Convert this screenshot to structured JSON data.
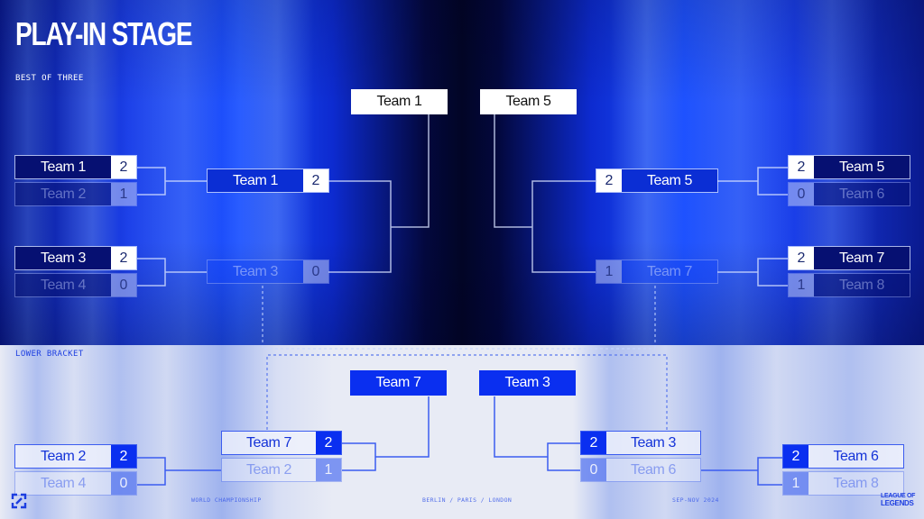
{
  "header": {
    "title": "PLAY-IN STAGE",
    "subtitle": "BEST OF THREE",
    "lower_label": "LOWER BRACKET"
  },
  "upper": {
    "left_r1": [
      {
        "top": {
          "team": "Team 1",
          "score": "2"
        },
        "bottom": {
          "team": "Team 2",
          "score": "1"
        }
      },
      {
        "top": {
          "team": "Team 3",
          "score": "2"
        },
        "bottom": {
          "team": "Team 4",
          "score": "0"
        }
      }
    ],
    "left_r2": {
      "top": {
        "team": "Team 1",
        "score": "2"
      },
      "bottom": {
        "team": "Team 3",
        "score": "0"
      }
    },
    "left_winner": "Team 1",
    "right_r1": [
      {
        "top": {
          "team": "Team 5",
          "score": "2"
        },
        "bottom": {
          "team": "Team 6",
          "score": "0"
        }
      },
      {
        "top": {
          "team": "Team 7",
          "score": "2"
        },
        "bottom": {
          "team": "Team 8",
          "score": "1"
        }
      }
    ],
    "right_r2": {
      "top": {
        "team": "Team 5",
        "score": "2"
      },
      "bottom": {
        "team": "Team 7",
        "score": "1"
      }
    },
    "right_winner": "Team 5"
  },
  "lower": {
    "left_r1": {
      "top": {
        "team": "Team 2",
        "score": "2"
      },
      "bottom": {
        "team": "Team 4",
        "score": "0"
      }
    },
    "left_r2": {
      "top": {
        "team": "Team 7",
        "score": "2"
      },
      "bottom": {
        "team": "Team 2",
        "score": "1"
      }
    },
    "left_winner": "Team 7",
    "right_r1": {
      "top": {
        "team": "Team 6",
        "score": "2"
      },
      "bottom": {
        "team": "Team 8",
        "score": "1"
      }
    },
    "right_r2": {
      "top": {
        "team": "Team 3",
        "score": "2"
      },
      "bottom": {
        "team": "Team 6",
        "score": "0"
      }
    },
    "right_winner": "Team 3"
  },
  "footer": {
    "event": "WORLD CHAMPIONSHIP",
    "cities": "BERLIN / PARIS / LONDON",
    "dates": "SEP-NOV 2024",
    "logo_line1": "LEAGUE OF",
    "logo_line2": "LEGENDS"
  },
  "icons": {
    "expand": "expand-icon"
  },
  "colors": {
    "accent": "#0a2ff0",
    "dark_bg": "#020526",
    "light_bg": "#e8ebf5"
  }
}
